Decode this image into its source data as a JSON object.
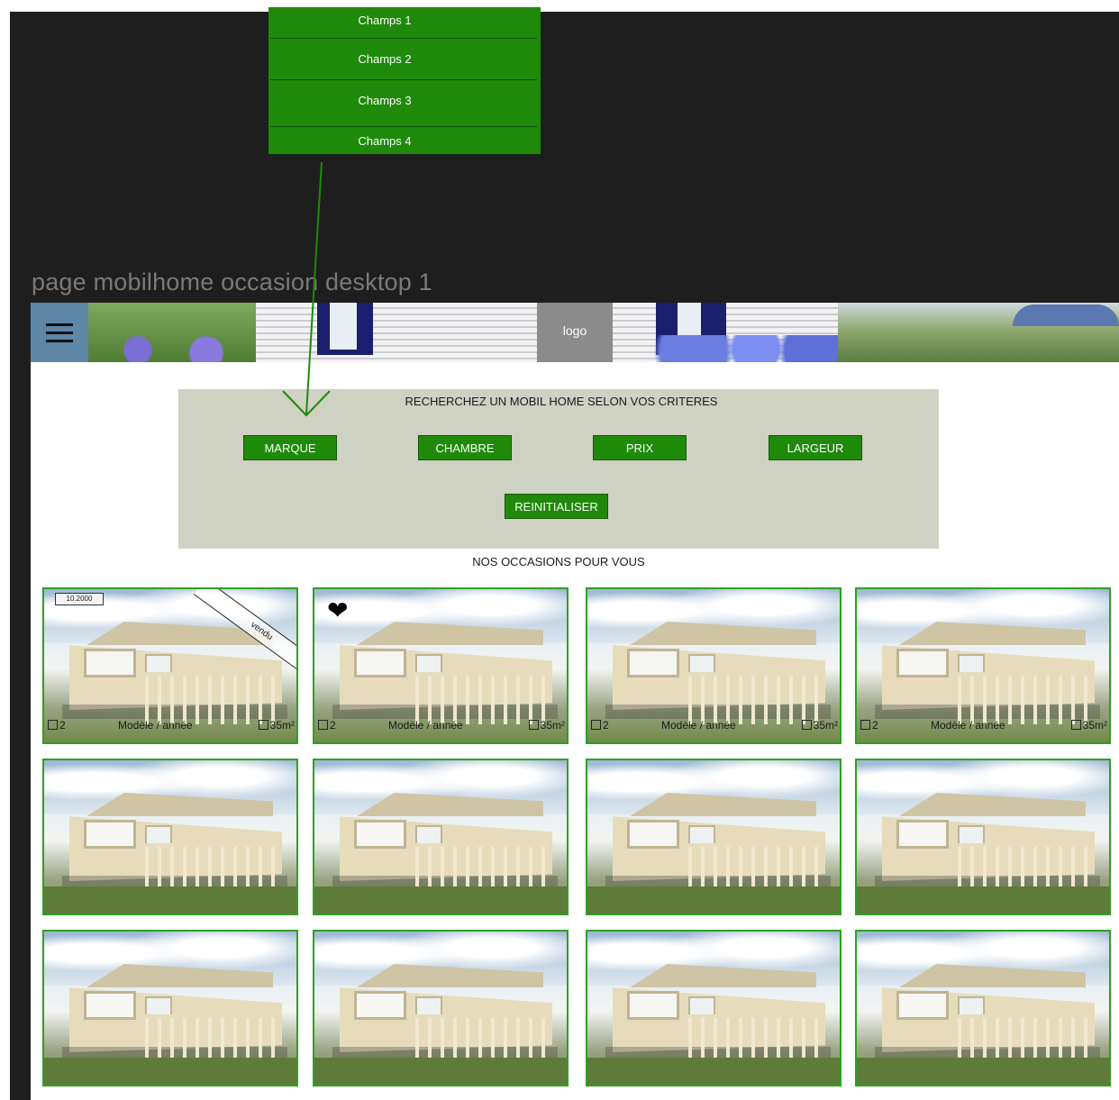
{
  "dropdown": {
    "items": [
      "Champs 1",
      "Champs 2",
      "Champs 3",
      "Champs 4"
    ]
  },
  "frame_label": "page mobilhome occasion desktop 1",
  "header": {
    "menu_icon": "hamburger-icon",
    "logo_text": "logo"
  },
  "search": {
    "title": "RECHERCHEZ  UN MOBIL HOME SELON VOS CRITERES",
    "filters": [
      "MARQUE",
      "CHAMBRE",
      "PRIX",
      "LARGEUR"
    ],
    "reset_label": "REINITIALISER"
  },
  "listing": {
    "title": "NOS OCCASIONS POUR VOUS",
    "card_info": {
      "beds": "2",
      "model": "Modèle / année",
      "area": "35m²"
    },
    "badges": {
      "date": "10.2000",
      "sold": "vendu",
      "favorite_icon": "heart-icon"
    }
  },
  "colors": {
    "canvas": "#1e1e1e",
    "accent_green": "#1f8a0a",
    "card_border": "#2ea023",
    "panel": "#cfd1c3",
    "menu_blue": "#5e86a6"
  }
}
